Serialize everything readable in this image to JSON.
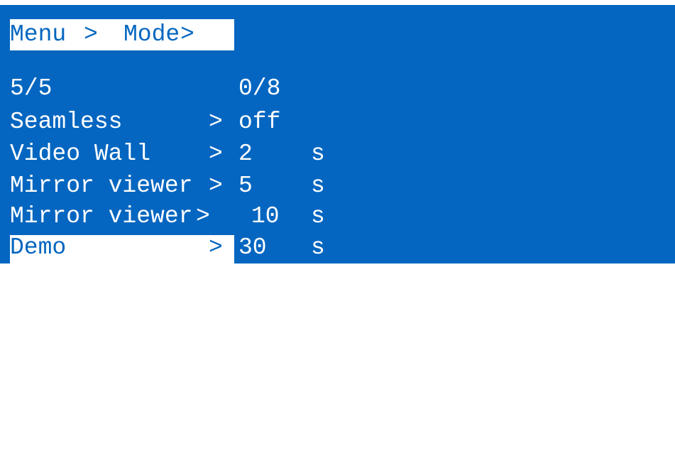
{
  "breadcrumb": {
    "menu": "Menu",
    "sep1": ">",
    "mode": "Mode",
    "sep2": ">"
  },
  "pager": {
    "page": "5/5",
    "count": "0/8"
  },
  "rows": [
    {
      "name": "Seamless",
      "arrow": ">",
      "value": "off",
      "unit": ""
    },
    {
      "name": "Video Wall",
      "arrow": ">",
      "value": "2",
      "unit": "s"
    },
    {
      "name": "Mirror viewer",
      "arrow": ">",
      "value": "5",
      "unit": "s"
    },
    {
      "name": "Mirror viewer",
      "arrow": ">",
      "value": "10",
      "unit": "s"
    },
    {
      "name": "Demo",
      "arrow": ">",
      "value": "30",
      "unit": "s"
    }
  ],
  "selected_row": "Demo",
  "colors": {
    "background": "#0466c0",
    "text": "#ffffff",
    "highlight": "#ffffff"
  }
}
